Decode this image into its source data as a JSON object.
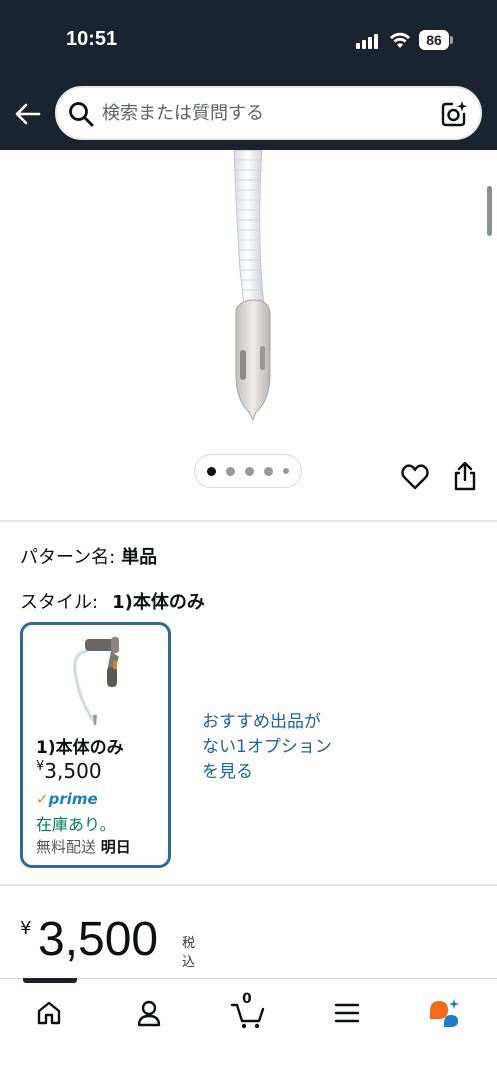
{
  "status_bar": {
    "time": "10:51",
    "battery": "86"
  },
  "header": {
    "search_placeholder": "検索または質問する"
  },
  "gallery": {
    "image_count": 5,
    "active_index": 0
  },
  "variations": {
    "pattern_label": "パターン名:",
    "pattern_value": "単品",
    "style_label": "スタイル:",
    "style_value": "1)本体のみ"
  },
  "variant_card": {
    "name": "1)本体のみ",
    "price_symbol": "¥",
    "price": "3,500",
    "prime": "prime",
    "stock": "在庫あり。",
    "shipping_label": "無料配送",
    "shipping_day": "明日"
  },
  "more_options": "おすすめ出品がない1オプションを見る",
  "price": {
    "symbol": "¥",
    "amount": "3,500",
    "tax_note": "税込"
  },
  "bottom_nav": {
    "cart_count": "0"
  },
  "colors": {
    "header_bg": "#1a2330",
    "card_border": "#2a6b9a",
    "link": "#2162a1",
    "in_stock": "#067d62",
    "prime_blue": "#1d7fc4",
    "prime_check": "#f08804"
  }
}
